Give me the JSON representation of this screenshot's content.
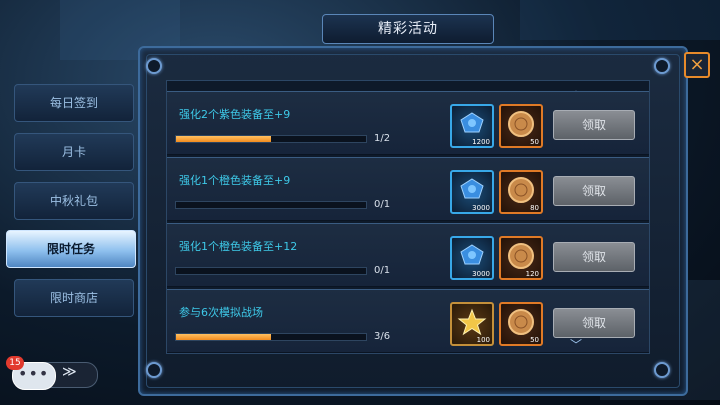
{
  "title": "精彩活动",
  "tabs": [
    {
      "label": "每日签到",
      "active": false
    },
    {
      "label": "月卡",
      "active": false
    },
    {
      "label": "中秋礼包",
      "active": false
    },
    {
      "label": "限时任务",
      "active": true
    },
    {
      "label": "限时商店",
      "active": false
    }
  ],
  "tasks": [
    {
      "title": "强化2个紫色装备至+9",
      "progress_text": "1/2",
      "progress": 0.5,
      "rewards": [
        {
          "icon": "blue-crystal-icon",
          "qty": "1200"
        },
        {
          "icon": "mooncake-icon",
          "qty": "50"
        }
      ],
      "button": "领取"
    },
    {
      "title": "强化1个橙色装备至+9",
      "progress_text": "0/1",
      "progress": 0,
      "rewards": [
        {
          "icon": "blue-crystal-icon",
          "qty": "3000"
        },
        {
          "icon": "mooncake-icon",
          "qty": "80"
        }
      ],
      "button": "领取"
    },
    {
      "title": "强化1个橙色装备至+12",
      "progress_text": "0/1",
      "progress": 0,
      "rewards": [
        {
          "icon": "blue-crystal-icon",
          "qty": "3000"
        },
        {
          "icon": "mooncake-icon",
          "qty": "120"
        }
      ],
      "button": "领取"
    },
    {
      "title": "参与6次模拟战场",
      "progress_text": "3/6",
      "progress": 0.5,
      "rewards": [
        {
          "icon": "gold-star-icon",
          "qty": "100"
        },
        {
          "icon": "mooncake-icon",
          "qty": "50"
        }
      ],
      "button": "领取"
    }
  ],
  "scroll": {
    "up": "︿",
    "down": "﹀"
  },
  "close_icon": "×",
  "chat": {
    "badge": "15",
    "dots": "•••",
    "arrows": "≫"
  },
  "colors": {
    "accent_cyan": "#3ec9e8",
    "progress_orange": "#f28c1e",
    "close_orange": "#e88a2a"
  }
}
